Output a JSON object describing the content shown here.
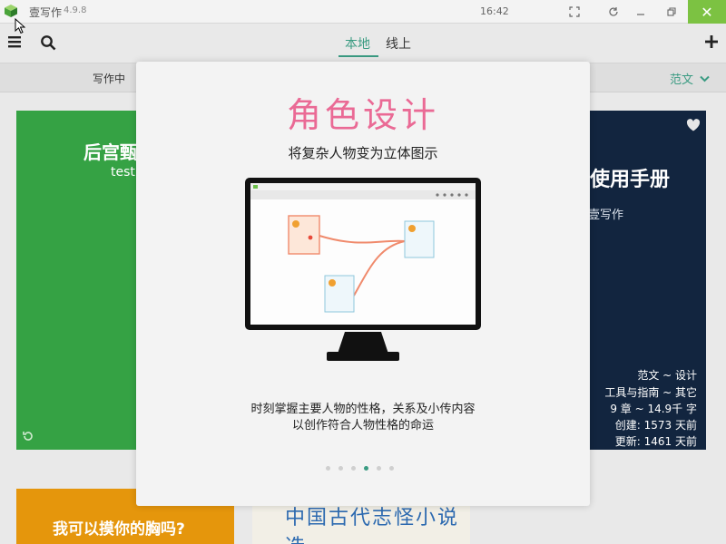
{
  "titlebar": {
    "app_name": "壹写作",
    "version": "4.9.8",
    "clock": "16:42",
    "close_symbol": "✕"
  },
  "toolbar": {
    "tabs": [
      {
        "label": "本地",
        "active": true
      },
      {
        "label": "线上",
        "active": false
      }
    ],
    "icons": [
      "menu-icon",
      "search-icon",
      "plus-icon"
    ]
  },
  "filter": {
    "left_label": "写作中",
    "right_label": "范文"
  },
  "cards": {
    "green": {
      "title": "后宫甄嬛",
      "subtitle": "test"
    },
    "navy": {
      "title": "使用手册",
      "subtitle": "壹写作",
      "meta": [
        "范文 ~ 设计",
        "工具与指南 ~ 其它",
        "9 章 ~ 14.9千 字",
        "创建: 1573 天前",
        "更新: 1461 天前"
      ]
    },
    "orange": {
      "title": "我可以摸你的胸吗?"
    },
    "book": {
      "title": "中国古代志怪小说选"
    }
  },
  "modal": {
    "title": "角色设计",
    "subtitle": "将复杂人物变为立体图示",
    "description": [
      "时刻掌握主要人物的性格，关系及小传内容",
      "以创作符合人物性格的命运"
    ],
    "pagination": {
      "total": 6,
      "active_index": 3
    }
  },
  "colors": {
    "accent": "#3a9b82",
    "modal_title": "#ea6a95",
    "close_button": "#7cc242",
    "card_green": "#35a244",
    "card_navy": "#12253f",
    "card_orange": "#e5960c"
  }
}
